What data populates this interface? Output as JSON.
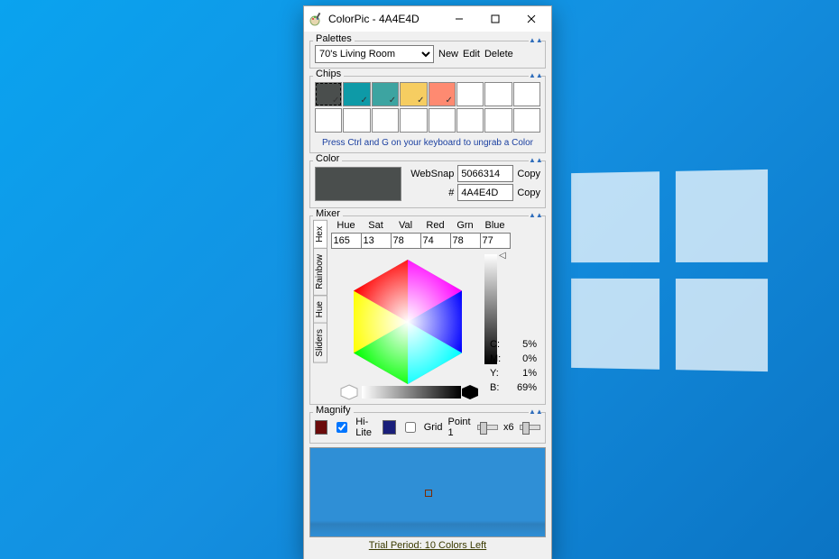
{
  "window": {
    "title": "ColorPic - 4A4E4D"
  },
  "palettes": {
    "label": "Palettes",
    "selected": "70's Living Room",
    "new": "New",
    "edit": "Edit",
    "delete": "Delete"
  },
  "chips": {
    "label": "Chips",
    "hint": "Press Ctrl and G on your keyboard to ungrab a Color",
    "row1": [
      {
        "color": "#4A4E4D",
        "tick": true,
        "selected": true
      },
      {
        "color": "#0E9AA7",
        "tick": true
      },
      {
        "color": "#3DA4A1",
        "tick": true
      },
      {
        "color": "#F6CD61",
        "tick": true
      },
      {
        "color": "#FE8A71",
        "tick": true
      },
      {
        "color": "#FFFFFF"
      },
      {
        "color": "#FFFFFF"
      },
      {
        "color": "#FFFFFF"
      }
    ],
    "row2": [
      {
        "color": "#FFFFFF"
      },
      {
        "color": "#FFFFFF"
      },
      {
        "color": "#FFFFFF"
      },
      {
        "color": "#FFFFFF"
      },
      {
        "color": "#FFFFFF"
      },
      {
        "color": "#FFFFFF"
      },
      {
        "color": "#FFFFFF"
      },
      {
        "color": "#FFFFFF"
      }
    ]
  },
  "color": {
    "label": "Color",
    "swatch": "#4A4E4D",
    "websnap_label": "WebSnap",
    "websnap": "5066314",
    "hash_label": "#",
    "hex": "4A4E4D",
    "copy": "Copy"
  },
  "mixer": {
    "label": "Mixer",
    "tabs": [
      "Hex",
      "Rainbow",
      "Hue",
      "Sliders"
    ],
    "cols": [
      {
        "l": "Hue",
        "v": "165"
      },
      {
        "l": "Sat",
        "v": "13"
      },
      {
        "l": "Val",
        "v": "78"
      },
      {
        "l": "Red",
        "v": "74"
      },
      {
        "l": "Grn",
        "v": "78"
      },
      {
        "l": "Blue",
        "v": "77"
      }
    ],
    "cmyb": [
      {
        "k": "C:",
        "v": "5%"
      },
      {
        "k": "M:",
        "v": "0%"
      },
      {
        "k": "Y:",
        "v": "1%"
      },
      {
        "k": "B:",
        "v": "69%"
      }
    ]
  },
  "magnify": {
    "label": "Magnify",
    "hilite": "Hi-Lite",
    "grid": "Grid",
    "point": "Point 1",
    "zoom": "x6",
    "swatch_a": "#6b0b0b",
    "swatch_b": "#1a1f7a"
  },
  "status": "Trial Period: 10 Colors Left"
}
